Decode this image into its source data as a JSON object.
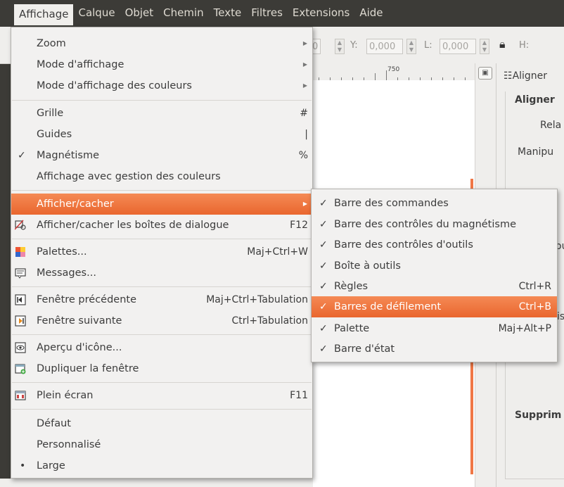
{
  "menubar": [
    "Affichage",
    "Calque",
    "Objet",
    "Chemin",
    "Texte",
    "Filtres",
    "Extensions",
    "Aide"
  ],
  "toolbar": {
    "x_value": "0",
    "y_label": "Y:",
    "y_value": "0,000",
    "l_label": "L:",
    "l_value": "0,000",
    "h_label": "H:"
  },
  "ruler": {
    "mark": "750"
  },
  "dock": {
    "tab_label": "Aligner",
    "heading": "Aligner",
    "rela": "Rela",
    "manip": "Manipu",
    "ou": "ou",
    "ise": "ise",
    "supprim": "Supprim"
  },
  "main_menu": {
    "zoom": "Zoom",
    "mode_affichage": "Mode d'affichage",
    "mode_couleurs": "Mode d'affichage des couleurs",
    "grille": "Grille",
    "grille_acc": "#",
    "guides": "Guides",
    "guides_acc": "|",
    "magnetisme": "Magnétisme",
    "magnetisme_acc": "%",
    "gestion_couleurs": "Affichage avec gestion des couleurs",
    "afficher_cacher": "Afficher/cacher",
    "boites_dialogue": "Afficher/cacher les boîtes de dialogue",
    "boites_dialogue_acc": "F12",
    "palettes": "Palettes...",
    "palettes_acc": "Maj+Ctrl+W",
    "messages": "Messages...",
    "fenetre_prec": "Fenêtre précédente",
    "fenetre_prec_acc": "Maj+Ctrl+Tabulation",
    "fenetre_suiv": "Fenêtre suivante",
    "fenetre_suiv_acc": "Ctrl+Tabulation",
    "apercu_icone": "Aperçu d'icône...",
    "dupliquer": "Dupliquer la fenêtre",
    "plein_ecran": "Plein écran",
    "plein_ecran_acc": "F11",
    "defaut": "Défaut",
    "personnalise": "Personnalisé",
    "large": "Large",
    "check": "✓",
    "bullet": "•"
  },
  "sub_menu": {
    "commandes": "Barre des commandes",
    "magnetisme": "Barre des contrôles du magnétisme",
    "outils_ctrl": "Barre des contrôles d'outils",
    "boite_outils": "Boîte à outils",
    "regles": "Règles",
    "regles_acc": "Ctrl+R",
    "defilement": "Barres de défilement",
    "defilement_acc": "Ctrl+B",
    "palette": "Palette",
    "palette_acc": "Maj+Alt+P",
    "etat": "Barre d'état",
    "check": "✓"
  },
  "colors": {
    "highlight": "#f07746",
    "menu_bg": "#f2f1f0",
    "menubar_bg": "#3c3b37"
  }
}
